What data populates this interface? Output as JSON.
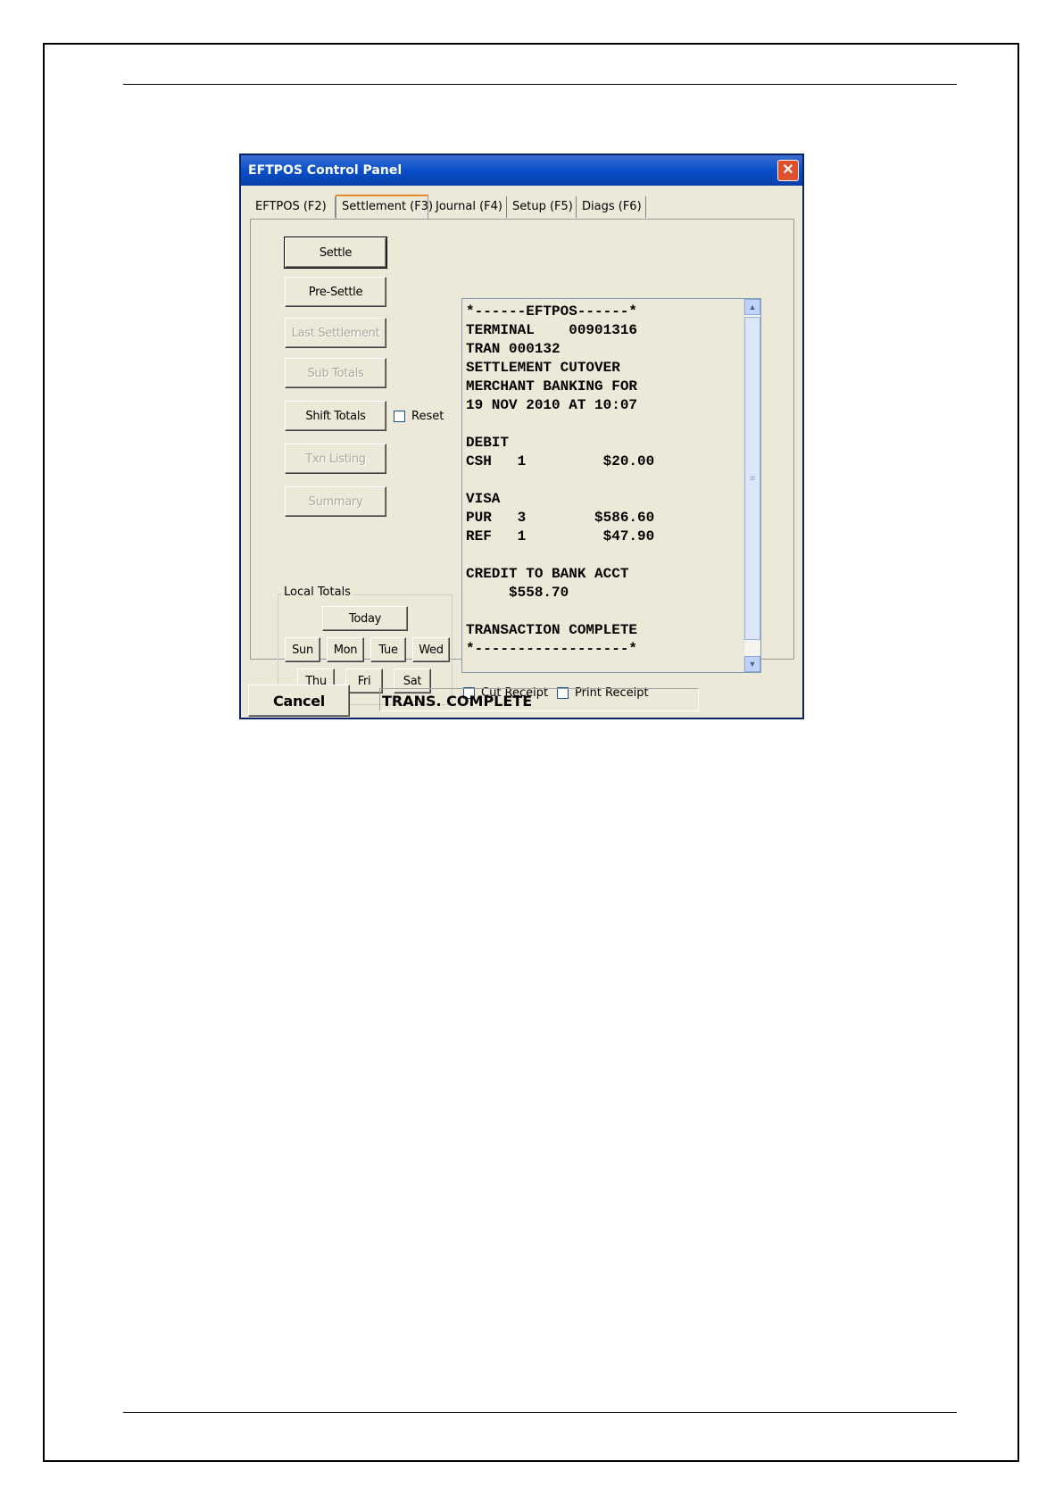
{
  "window": {
    "title": "EFTPOS Control Panel"
  },
  "tabs": [
    {
      "label": "EFTPOS (F2)"
    },
    {
      "label": "Settlement (F3)"
    },
    {
      "label": "Journal (F4)"
    },
    {
      "label": "Setup (F5)"
    },
    {
      "label": "Diags (F6)"
    }
  ],
  "settlement": {
    "buttons": {
      "settle": "Settle",
      "pre_settle": "Pre-Settle",
      "last_settlement": "Last Settlement",
      "sub_totals": "Sub Totals",
      "shift_totals": "Shift Totals",
      "txn_listing": "Txn Listing",
      "summary": "Summary"
    },
    "reset_label": "Reset",
    "local_totals": {
      "title": "Local Totals",
      "today": "Today",
      "days": [
        "Sun",
        "Mon",
        "Tue",
        "Wed",
        "Thu",
        "Fri",
        "Sat"
      ]
    },
    "receipt_lines": [
      "*------EFTPOS------*",
      "TERMINAL    00901316",
      "TRAN 000132",
      "SETTLEMENT CUTOVER",
      "MERCHANT BANKING FOR",
      "19 NOV 2010 AT 10:07",
      "",
      "DEBIT",
      "CSH   1         $20.00",
      "",
      "VISA",
      "PUR   3        $586.60",
      "REF   1         $47.90",
      "",
      "CREDIT TO BANK ACCT",
      "     $558.70",
      "",
      "TRANSACTION COMPLETE",
      "*------------------*"
    ],
    "cut_receipt_label": "Cut Receipt",
    "print_receipt_label": "Print Receipt"
  },
  "footer": {
    "cancel_label": "Cancel",
    "status_text": "TRANS. COMPLETE"
  }
}
